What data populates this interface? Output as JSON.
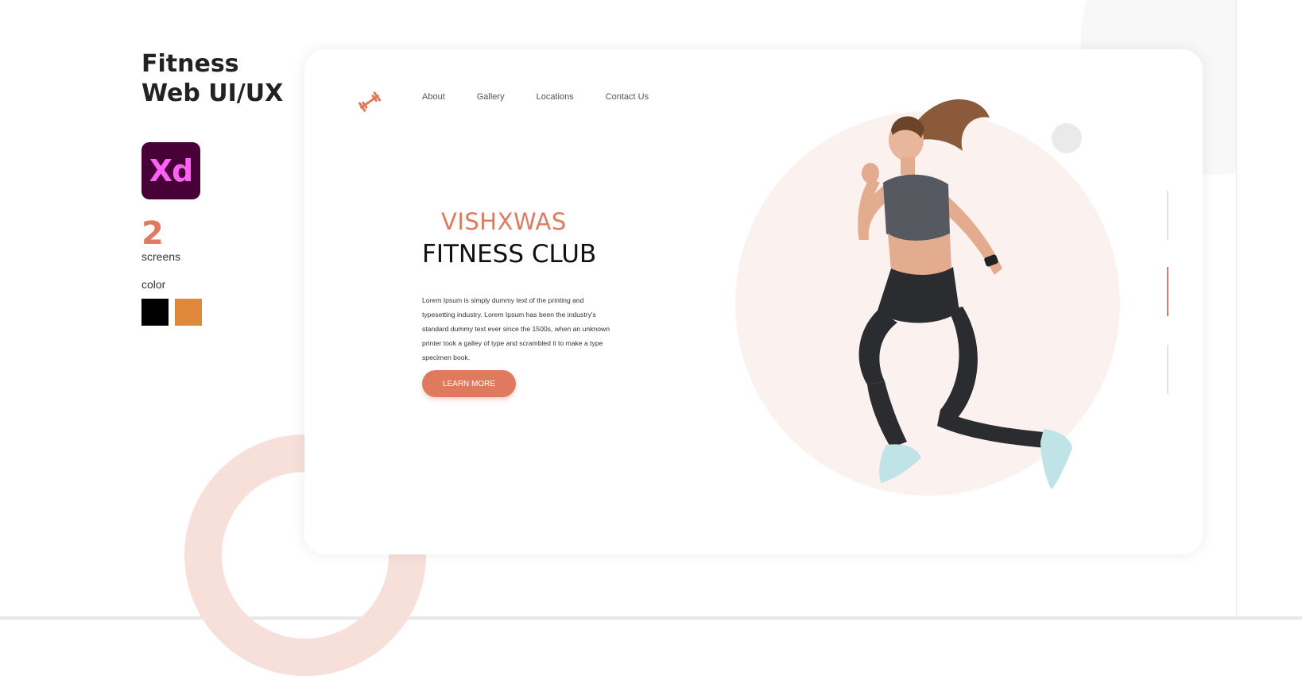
{
  "info": {
    "title_line1": "Fitness",
    "title_line2": "Web UI/UX",
    "app_logo_text": "Xd",
    "screens_count": "2",
    "screens_label": "screens",
    "color_label": "color",
    "swatches": [
      "#000000",
      "#e0883a"
    ]
  },
  "mockup": {
    "logo_icon": "dumbbell-icon",
    "nav": [
      "About",
      "Gallery",
      "Locations",
      "Contact Us"
    ],
    "brand_line1": "VISHXWAS",
    "brand_line2": "FITNESS CLUB",
    "description": "Lorem Ipsum is simply dummy text of the printing and typesetting industry. Lorem Ipsum has been the industry's standard dummy text ever since the 1500s, when an unknown printer took a galley of type and scrambled it to make a type specimen book.",
    "cta_label": "LEARN MORE",
    "slide_indicators": 3,
    "active_slide": 2
  },
  "colors": {
    "accent": "#e07a5f",
    "accent_light": "#f7e0d9",
    "text_dark": "#111111"
  }
}
